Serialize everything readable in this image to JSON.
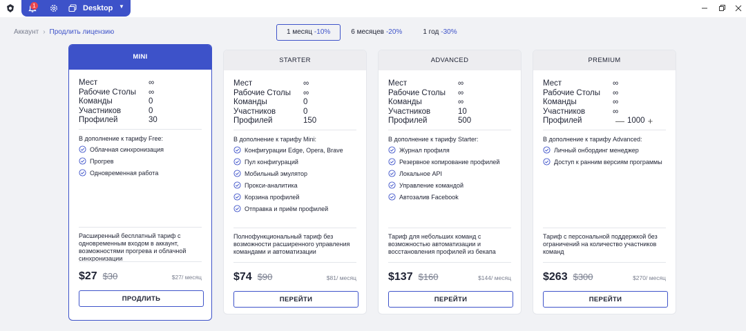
{
  "titlebar": {
    "notification_count": "1",
    "workspace_label": "Desktop"
  },
  "breadcrumb": {
    "root": "Аккаунт",
    "current": "Продлить лицензию"
  },
  "periods": [
    {
      "label": "1 месяц",
      "discount": "-10%",
      "active": true
    },
    {
      "label": "6 месяцев",
      "discount": "-20%",
      "active": false
    },
    {
      "label": "1 год",
      "discount": "-30%",
      "active": false
    }
  ],
  "plans": [
    {
      "name": "MINI",
      "selected": true,
      "stats": [
        {
          "label": "Мест",
          "value": "∞"
        },
        {
          "label": "Рабочие Столы",
          "value": "∞"
        },
        {
          "label": "Команды",
          "value": "0"
        },
        {
          "label": "Участников",
          "value": "0"
        },
        {
          "label": "Профилей",
          "value": "30"
        }
      ],
      "features_title": "В дополнение к тарифу Free:",
      "features": [
        "Облачная синхронизация",
        "Прогрев",
        "Одновременная работа"
      ],
      "description": "Расширенный бесплатный тариф с одновременным входом в аккаунт, возможностями прогрева и облачной синхронизации",
      "price": "$27",
      "old_price": "$30",
      "per_month": "$27/ месяц",
      "action": "ПРОДЛИТЬ"
    },
    {
      "name": "STARTER",
      "selected": false,
      "stats": [
        {
          "label": "Мест",
          "value": "∞"
        },
        {
          "label": "Рабочие Столы",
          "value": "∞"
        },
        {
          "label": "Команды",
          "value": "0"
        },
        {
          "label": "Участников",
          "value": "0"
        },
        {
          "label": "Профилей",
          "value": "150"
        }
      ],
      "features_title": "В дополнение к тарифу Mini:",
      "features": [
        "Конфигурации Edge, Opera, Brave",
        "Пул конфигураций",
        "Мобильный эмулятор",
        "Прокси-аналитика",
        "Корзина профилей",
        "Отправка и приём профилей"
      ],
      "description": "Полнофункциональный тариф без возможности расширенного управления командами и автоматизации",
      "price": "$74",
      "old_price": "$90",
      "per_month": "$81/ месяц",
      "action": "ПЕРЕЙТИ"
    },
    {
      "name": "ADVANCED",
      "selected": false,
      "stats": [
        {
          "label": "Мест",
          "value": "∞"
        },
        {
          "label": "Рабочие Столы",
          "value": "∞"
        },
        {
          "label": "Команды",
          "value": "∞"
        },
        {
          "label": "Участников",
          "value": "10"
        },
        {
          "label": "Профилей",
          "value": "500"
        }
      ],
      "features_title": "В дополнение к тарифу Starter:",
      "features": [
        "Журнал профиля",
        "Резервное копирование профилей",
        "Локальное API",
        "Управление командой",
        "Автозалив Facebook"
      ],
      "description": "Тариф для небольших команд с возможностью автоматизации и восстановления профилей из бекапа",
      "price": "$137",
      "old_price": "$160",
      "per_month": "$144/ месяц",
      "action": "ПЕРЕЙТИ"
    },
    {
      "name": "PREMIUM",
      "selected": false,
      "stats": [
        {
          "label": "Мест",
          "value": "∞"
        },
        {
          "label": "Рабочие Столы",
          "value": "∞"
        },
        {
          "label": "Команды",
          "value": "∞"
        },
        {
          "label": "Участников",
          "value": "∞"
        },
        {
          "label": "Профилей",
          "value": "1000",
          "stepper": true
        }
      ],
      "features_title": "В дополнение к тарифу Advanced:",
      "features": [
        "Личный онбординг менеджер",
        "Доступ к ранним версиям программы"
      ],
      "description": "Тариф с персональной поддержкой без ограничений на количество участников команд",
      "price": "$263",
      "old_price": "$300",
      "per_month": "$270/ месяц",
      "action": "ПЕРЕЙТИ"
    }
  ],
  "colors": {
    "accent": "#3d52c9",
    "background": "#f1f2f5",
    "badge": "#e8464e"
  },
  "icons": [
    "app-logo-icon",
    "bell-icon",
    "gear-icon",
    "desktops-icon",
    "chevron-down-icon",
    "minimize-icon",
    "maximize-icon",
    "close-icon",
    "check-circle-icon",
    "minus-icon",
    "plus-icon"
  ]
}
